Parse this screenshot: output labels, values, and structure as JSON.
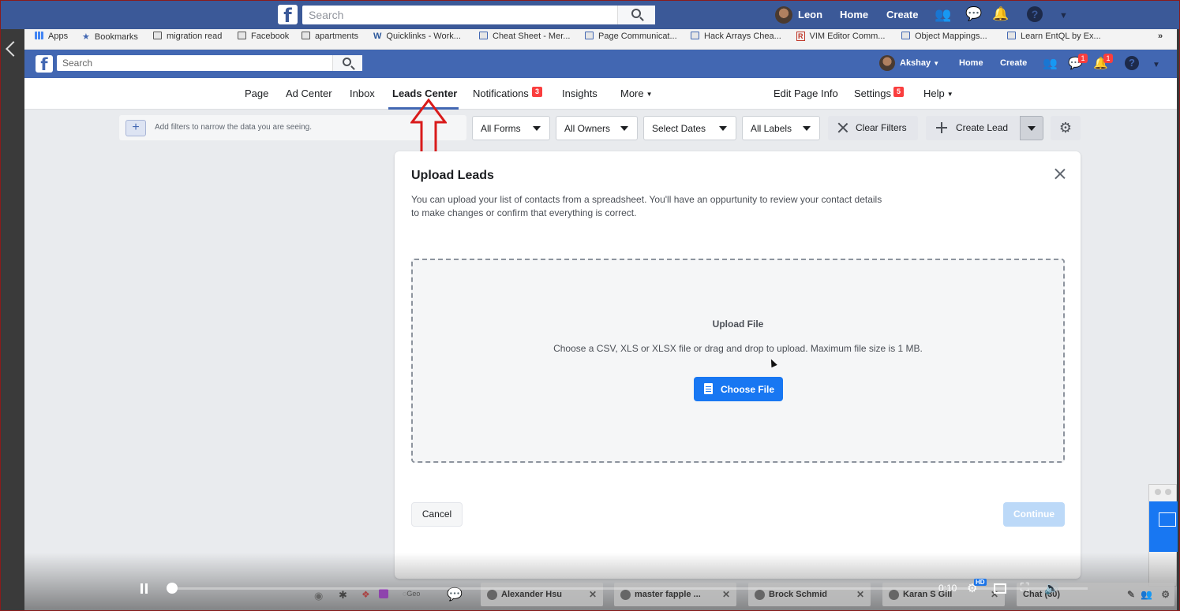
{
  "outer": {
    "search_placeholder": "Search",
    "user": "Leon",
    "home": "Home",
    "create": "Create"
  },
  "bookmarks": [
    {
      "label": "Apps"
    },
    {
      "label": "Bookmarks"
    },
    {
      "label": "migration read"
    },
    {
      "label": "Facebook"
    },
    {
      "label": "apartments"
    },
    {
      "label": "Quicklinks - Work..."
    },
    {
      "label": "Cheat Sheet - Mer..."
    },
    {
      "label": "Page Communicat..."
    },
    {
      "label": "Hack Arrays Chea..."
    },
    {
      "label": "VIM Editor Comm..."
    },
    {
      "label": "Object Mappings..."
    },
    {
      "label": "Learn EntQL by Ex..."
    },
    {
      "label": "»"
    }
  ],
  "inner": {
    "search_placeholder": "Search",
    "user": "Akshay",
    "home": "Home",
    "create": "Create",
    "messages_badge": "1",
    "notifications_badge": "1"
  },
  "page_nav": {
    "items": [
      "Page",
      "Ad Center",
      "Inbox",
      "Leads Center",
      "Notifications",
      "Insights",
      "More"
    ],
    "notifications_badge": "3",
    "right_items": [
      "Edit Page Info",
      "Settings",
      "Help"
    ],
    "settings_badge": "5"
  },
  "filters": {
    "placeholder": "Add filters to narrow the data you are seeing.",
    "forms": "All Forms",
    "owners": "All Owners",
    "dates": "Select Dates",
    "labels": "All Labels",
    "clear": "Clear Filters",
    "create_lead": "Create Lead"
  },
  "modal": {
    "title": "Upload Leads",
    "description": "You can upload your list of contacts from a spreadsheet. You'll have an oppurtunity to review your contact details to make changes or confirm that everything is correct.",
    "upload_title": "Upload File",
    "upload_desc": "Choose a CSV, XLS or XLSX file or drag and drop to upload. Maximum file size is 1 MB.",
    "choose_file": "Choose File",
    "cancel": "Cancel",
    "continue": "Continue"
  },
  "video": {
    "time": "0:10",
    "hd": "HD",
    "progress": 0.0
  },
  "tasks": [
    {
      "label": "Alexander Hsu"
    },
    {
      "label": "master fapple ..."
    },
    {
      "label": "Brock Schmid"
    },
    {
      "label": "Karan S Gill"
    },
    {
      "label": "Chat (30)"
    }
  ]
}
